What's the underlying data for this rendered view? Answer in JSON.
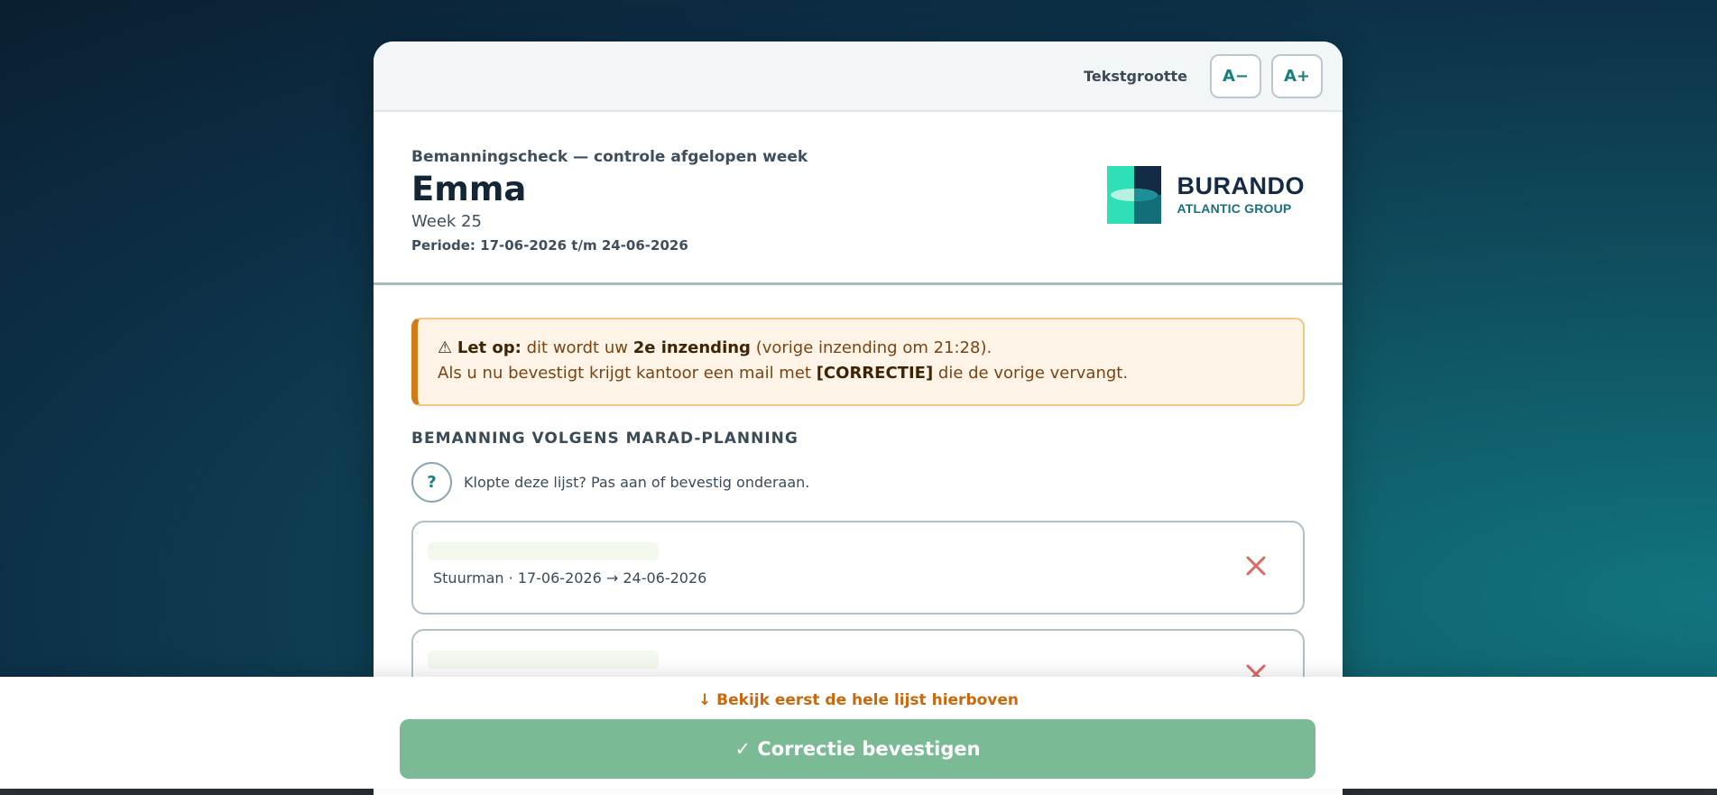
{
  "toolbar": {
    "text_size_label": "Tekstgrootte",
    "decrease_label": "A−",
    "increase_label": "A+"
  },
  "header": {
    "kicker": "Bemanningscheck — controle afgelopen week",
    "vessel_name": "Emma",
    "week": "Week 25",
    "period": "Periode: 17-06-2026 t/m 24-06-2026"
  },
  "logo": {
    "brand": "BURANDO",
    "sub": "ATLANTIC GROUP"
  },
  "warning": {
    "prefix": "Let op:",
    "text1": "dit wordt uw",
    "emphasis": "2e inzending",
    "text2": "(vorige inzending om 21:28).",
    "line2_text1": "Als u nu bevestigt krijgt kantoor een mail met",
    "line2_emphasis": "[CORRECTIE]",
    "line2_text2": "die de vorige vervangt."
  },
  "section": {
    "title": "BEMANNING VOLGENS MARAD-PLANNING",
    "help_symbol": "?",
    "hint": "Klopte deze lijst? Pas aan of bevestig onderaan."
  },
  "crew": [
    {
      "meta": "Stuurman · 17-06-2026 → 24-06-2026"
    },
    {
      "meta": ""
    }
  ],
  "footer": {
    "scroll_hint": "↓ Bekijk eerst de hele lijst hierboven",
    "confirm_label": "✓ Correctie bevestigen"
  },
  "colors": {
    "accent": "#16807c",
    "warning_border": "#d27a14",
    "confirm": "#7aba94",
    "remove": "#d96a66"
  }
}
